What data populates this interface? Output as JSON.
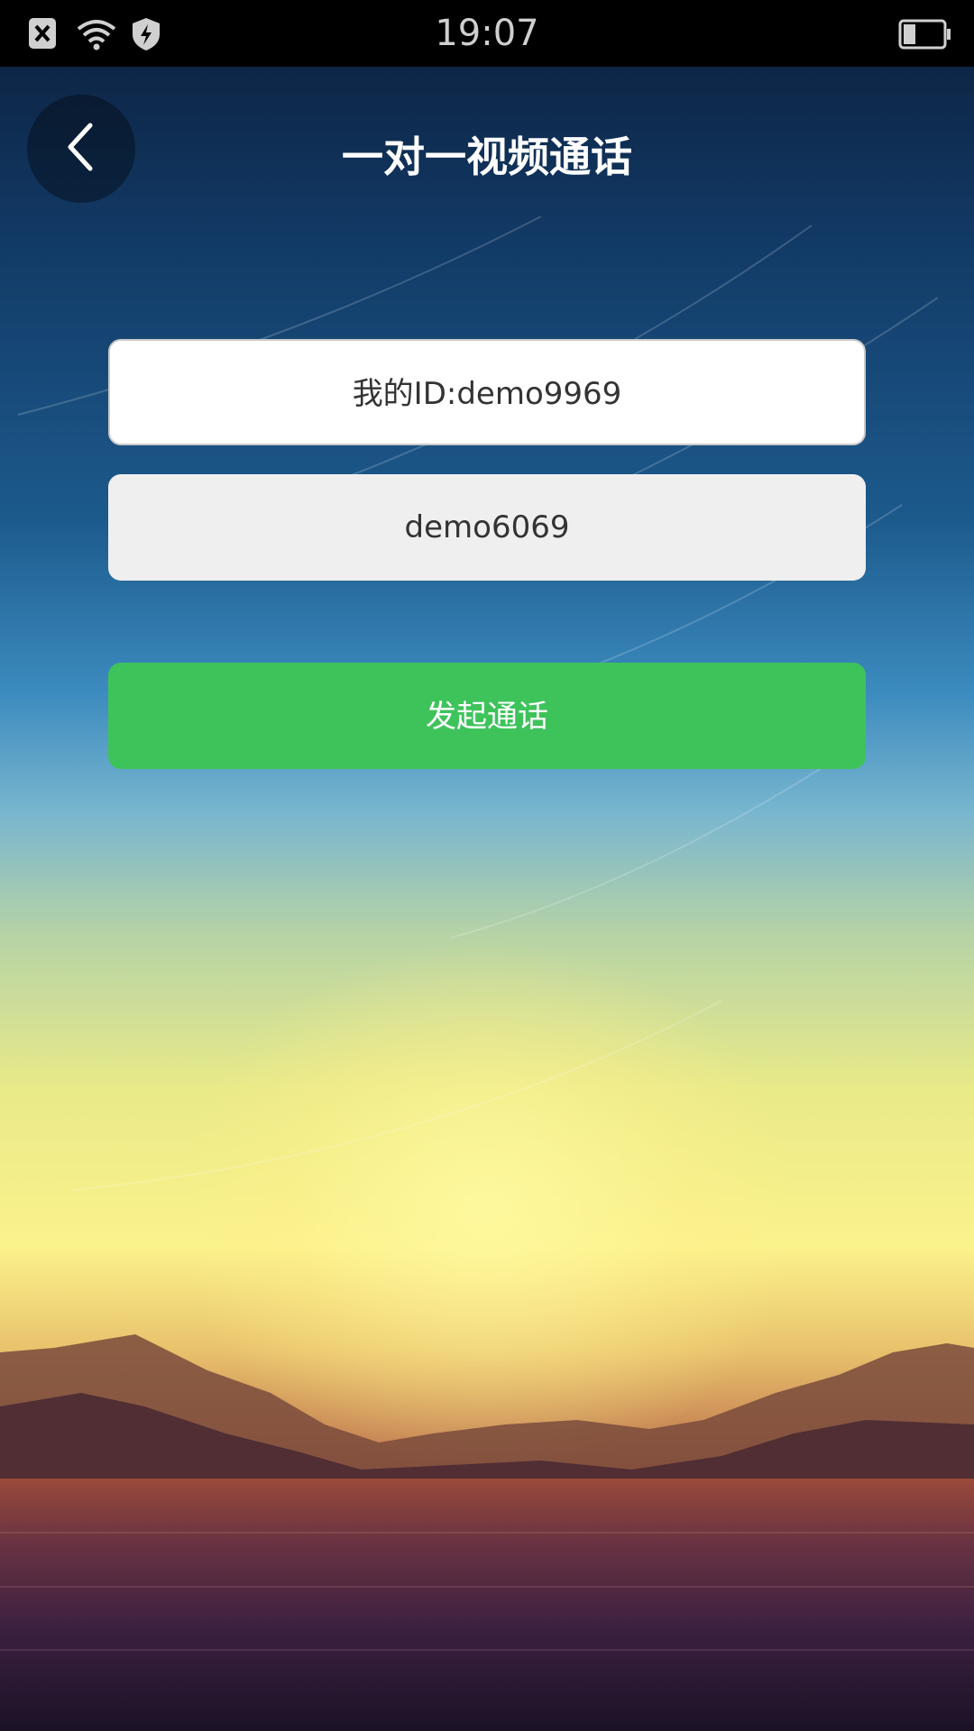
{
  "status_bar": {
    "time": "19:07",
    "icons": [
      "notification-blocked-icon",
      "wifi-icon",
      "shield-bolt-icon",
      "battery-icon"
    ],
    "battery_level": 0.3
  },
  "nav": {
    "title": "一对一视频通话",
    "back_icon": "chevron-left-icon"
  },
  "form": {
    "my_id_label": "我的ID:demo9969",
    "callee_value": "demo6069",
    "call_button_label": "发起通话"
  },
  "colors": {
    "primary_green": "#3ec35b",
    "field_white": "#ffffff",
    "field_grey": "#efefef",
    "status_bar_bg": "#000000"
  }
}
